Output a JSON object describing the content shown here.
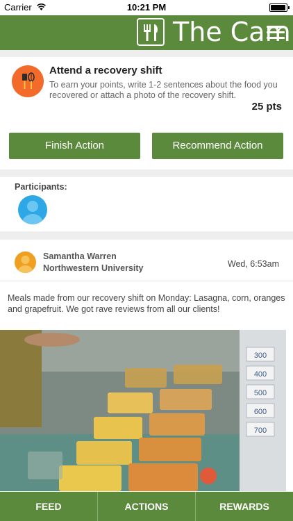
{
  "status_bar": {
    "carrier": "Carrier",
    "time": "10:21 PM"
  },
  "header": {
    "brand": "The Camp"
  },
  "action": {
    "title": "Attend a recovery shift",
    "description": "To earn your points, write 1-2 sentences about the food you recovered or attach a photo of the recovery shift.",
    "points": "25 pts",
    "finish_label": "Finish Action",
    "recommend_label": "Recommend Action"
  },
  "participants": {
    "label": "Participants:"
  },
  "post": {
    "author": "Samantha Warren",
    "school": "Northwestern University",
    "time": "Wed, 6:53am",
    "text": "Meals made from our recovery shift on Monday: Lasagna, corn, oranges and grapefruit. We got rave reviews from all our clients!",
    "photo_labels": [
      "300",
      "400",
      "500",
      "600",
      "700"
    ]
  },
  "tabs": [
    {
      "label": "FEED"
    },
    {
      "label": "ACTIONS"
    },
    {
      "label": "REWARDS"
    }
  ],
  "colors": {
    "brand_green": "#5c8a3c",
    "action_orange": "#f26b2a",
    "participant_blue": "#2ea7e6",
    "author_orange": "#f0a020"
  }
}
